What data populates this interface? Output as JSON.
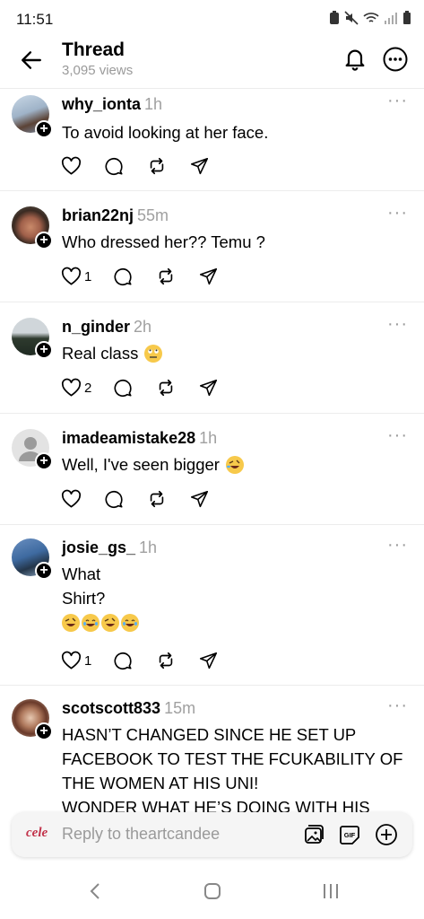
{
  "status": {
    "time": "11:51"
  },
  "header": {
    "title": "Thread",
    "views": "3,095 views"
  },
  "posts": [
    {
      "username": "why_ionta",
      "time": "1h",
      "text": "To avoid looking at her face.",
      "likes": ""
    },
    {
      "username": "brian22nj",
      "time": "55m",
      "text": "Who dressed her?? Temu ?",
      "likes": "1"
    },
    {
      "username": "n_ginder",
      "time": "2h",
      "text": "Real class",
      "likes": "2"
    },
    {
      "username": "imadeamistake28",
      "time": "1h",
      "text": "Well, I've seen bigger",
      "likes": ""
    },
    {
      "username": "josie_gs_",
      "time": "1h",
      "line1": "What",
      "line2": "Shirt?",
      "likes": "1"
    },
    {
      "username": "scotscott833",
      "time": "15m",
      "line1": "HASN’T CHANGED SINCE HE SET UP",
      "line2": "FACEBOOK TO TEST THE FCUKABILITY OF",
      "line3": "THE WOMEN AT HIS UNI!",
      "line4": "WONDER WHAT HE’S DOING WITH HIS"
    }
  ],
  "reply": {
    "logo_text": "cele",
    "placeholder": "Reply to theartcandee"
  },
  "icons": {
    "back": "arrow-left-icon",
    "bell": "bell-icon",
    "more": "more-circle-icon",
    "like": "heart-icon",
    "comment": "comment-icon",
    "repost": "repost-icon",
    "share": "send-icon",
    "image": "image-icon",
    "gif": "gif-icon",
    "add": "plus-circle-icon"
  }
}
